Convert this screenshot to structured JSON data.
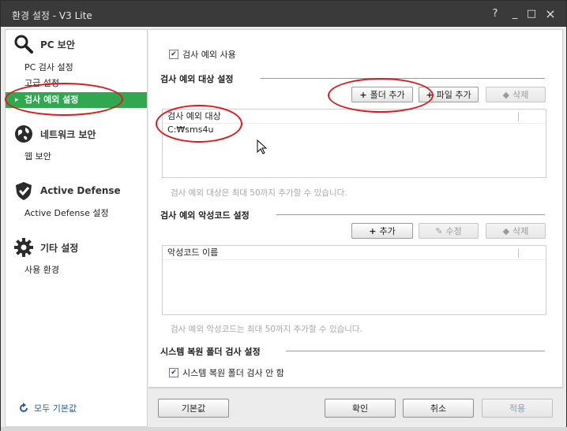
{
  "window": {
    "title": "환경 설정 - V3 Lite",
    "help_label": "?",
    "minimize_label": "_",
    "maximize_label": "□",
    "close_label": "×"
  },
  "sidebar": {
    "groups": [
      {
        "label": "PC 보안",
        "icon": "magnifier-icon",
        "items": [
          "PC 검사 설정",
          "고급 설정",
          "검사 예외 설정"
        ]
      },
      {
        "label": "네트워크 보안",
        "icon": "globe-icon",
        "items": [
          "웹 보안"
        ]
      },
      {
        "label": "Active Defense",
        "icon": "shield-check-icon",
        "items": [
          "Active Defense 설정"
        ]
      },
      {
        "label": "기타 설정",
        "icon": "gear-icon",
        "items": [
          "사용 환경"
        ]
      }
    ],
    "active_item": "검사 예외 설정",
    "reset_all_label": "모두 기본값"
  },
  "main": {
    "exclusion_enabled_label": "검사 예외 사용",
    "targets_section": {
      "title": "검사 예외 대상 설정",
      "add_folder_label": "폴더 추가",
      "add_file_label": "파일 추가",
      "delete_label": "삭제",
      "list_header": "검사 예외 대상",
      "items": [
        "C:₩sms4u"
      ],
      "hint": "검사 예외 대상은 최대 50까지 추가할 수 있습니다."
    },
    "malware_section": {
      "title": "검사 예외 악성코드 설정",
      "add_label": "추가",
      "edit_label": "수정",
      "delete_label": "삭제",
      "list_header": "악성코드 이름",
      "items": [],
      "hint": "검사 예외 악성코드는 최대 50까지 추가할 수 있습니다."
    },
    "restore_section": {
      "title": "시스템 복원 폴더 검사 설정",
      "skip_label": "시스템 복원 폴더 검사 안 함"
    }
  },
  "footer": {
    "defaults_label": "기본값",
    "ok_label": "확인",
    "cancel_label": "취소",
    "apply_label": "적용"
  },
  "colors": {
    "accent": "#2fa84f",
    "annotation": "#e01a1a",
    "titlebar": "#3a3a3a"
  }
}
